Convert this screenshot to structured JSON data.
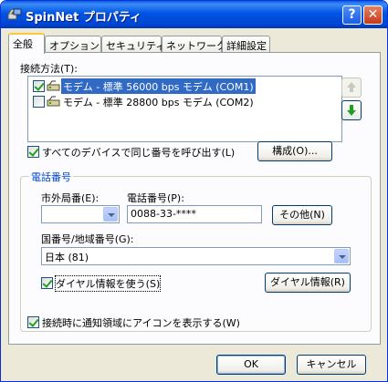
{
  "window": {
    "title": "SpinNet プロパティ",
    "help_label": "?",
    "close_label": "✕"
  },
  "tabs": [
    {
      "label": "全般",
      "active": true
    },
    {
      "label": "オプション",
      "active": false
    },
    {
      "label": "セキュリティ",
      "active": false
    },
    {
      "label": "ネットワーク",
      "active": false
    },
    {
      "label": "詳細設定",
      "active": false
    }
  ],
  "connect_using": {
    "label": "接続方法(T):",
    "devices": [
      {
        "label": "モデム - 標準 56000 bps モデム (COM1)",
        "checked": true,
        "selected": true
      },
      {
        "label": "モデム - 標準 28800 bps モデム (COM2)",
        "checked": false,
        "selected": false
      }
    ],
    "same_number_label": "すべてのデバイスで同じ番号を呼び出す(L)",
    "same_number_checked": true,
    "configure_label": "構成(O)..."
  },
  "phone": {
    "group_title": "電話番号",
    "area_code_label": "市外局番(E):",
    "area_code_value": "",
    "number_label": "電話番号(P):",
    "number_value": "0088-33-****",
    "alternates_label": "その他(N)",
    "country_label": "国番号/地域番号(G):",
    "country_value": "日本 (81)",
    "dialing_rules_label": "ダイヤル情報を使う(S)",
    "dialing_rules_checked": true,
    "dialing_rules_button": "ダイヤル情報(R)"
  },
  "show_icon_label": "接続時に通知領域にアイコンを表示する(W)",
  "show_icon_checked": true,
  "footer": {
    "ok_label": "OK",
    "cancel_label": "キャンセル"
  },
  "colors": {
    "title_bar": "#0054e3",
    "dialog_bg": "#ece9d8",
    "selection": "#316ac5",
    "group_title": "#0046d5"
  }
}
